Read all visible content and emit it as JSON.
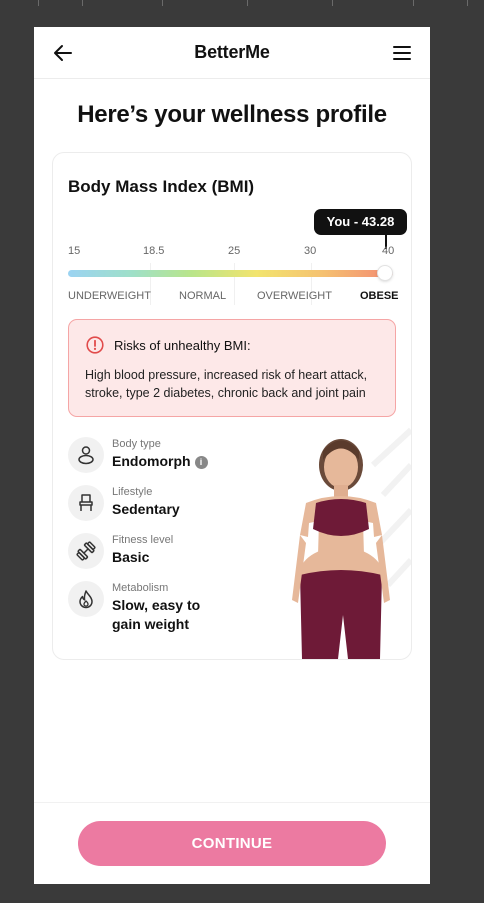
{
  "header": {
    "title": "BetterMe"
  },
  "page_title": "Here’s your wellness profile",
  "bmi": {
    "title": "Body Mass Index (BMI)",
    "you_label": "You - 43.28",
    "ticks": [
      "15",
      "18.5",
      "25",
      "30",
      "40"
    ],
    "categories": [
      "UNDERWEIGHT",
      "NORMAL",
      "OVERWEIGHT",
      "OBESE"
    ],
    "active_category": "OBESE",
    "value": 43.28
  },
  "risk": {
    "title": "Risks of unhealthy BMI:",
    "text": "High blood pressure, increased risk of heart attack, stroke, type 2 diabetes, chronic back and joint pain"
  },
  "traits": [
    {
      "label": "Body type",
      "value": "Endomorph",
      "icon": "body-icon"
    },
    {
      "label": "Lifestyle",
      "value": "Sedentary",
      "icon": "chair-icon"
    },
    {
      "label": "Fitness level",
      "value": "Basic",
      "icon": "dumbbell-icon"
    },
    {
      "label": "Metabolism",
      "value": "Slow, easy to gain weight",
      "icon": "flame-icon"
    }
  ],
  "continue_label": "CONTINUE",
  "colors": {
    "accent": "#ec7aa1",
    "risk_bg": "#fde8e8",
    "risk_border": "#f5a5a5",
    "risk_icon": "#e14b4b",
    "outfit": "#6e1a37"
  }
}
